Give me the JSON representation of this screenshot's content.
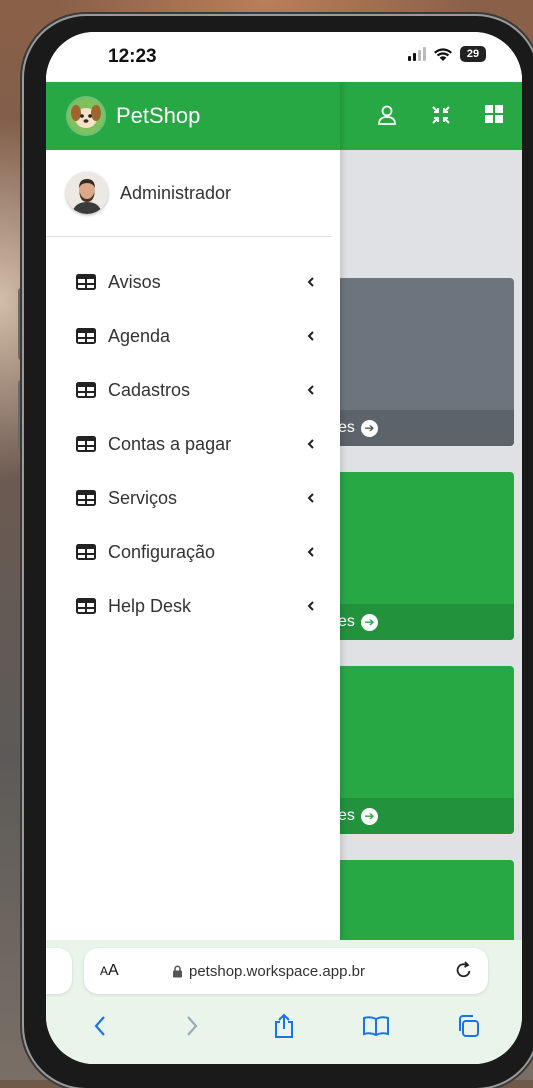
{
  "status_bar": {
    "time": "12:23",
    "battery": "29"
  },
  "app": {
    "brand_name": "PetShop",
    "header_icons": [
      "user-icon",
      "compress-icon",
      "grid-icon"
    ]
  },
  "drawer": {
    "user_name": "Administrador",
    "menu": [
      {
        "label": "Avisos",
        "icon": "table-icon"
      },
      {
        "label": "Agenda",
        "icon": "table-icon"
      },
      {
        "label": "Cadastros",
        "icon": "table-icon"
      },
      {
        "label": "Contas a pagar",
        "icon": "table-icon"
      },
      {
        "label": "Serviços",
        "icon": "table-icon"
      },
      {
        "label": "Configuração",
        "icon": "table-icon"
      },
      {
        "label": "Help Desk",
        "icon": "table-icon"
      }
    ]
  },
  "cards": [
    {
      "footer_text": "es",
      "color": "#6c757d"
    },
    {
      "footer_text": "es",
      "color": "#28a745"
    },
    {
      "footer_text": "es",
      "color": "#28a745"
    },
    {
      "footer_text": "",
      "color": "#28a745"
    }
  ],
  "safari": {
    "aa_label_small": "A",
    "aa_label_big": "A",
    "url": "petshop.workspace.app.br"
  },
  "colors": {
    "primary": "#28a745",
    "content_bg": "#dfe1e5",
    "card_gray": "#6c757d"
  }
}
